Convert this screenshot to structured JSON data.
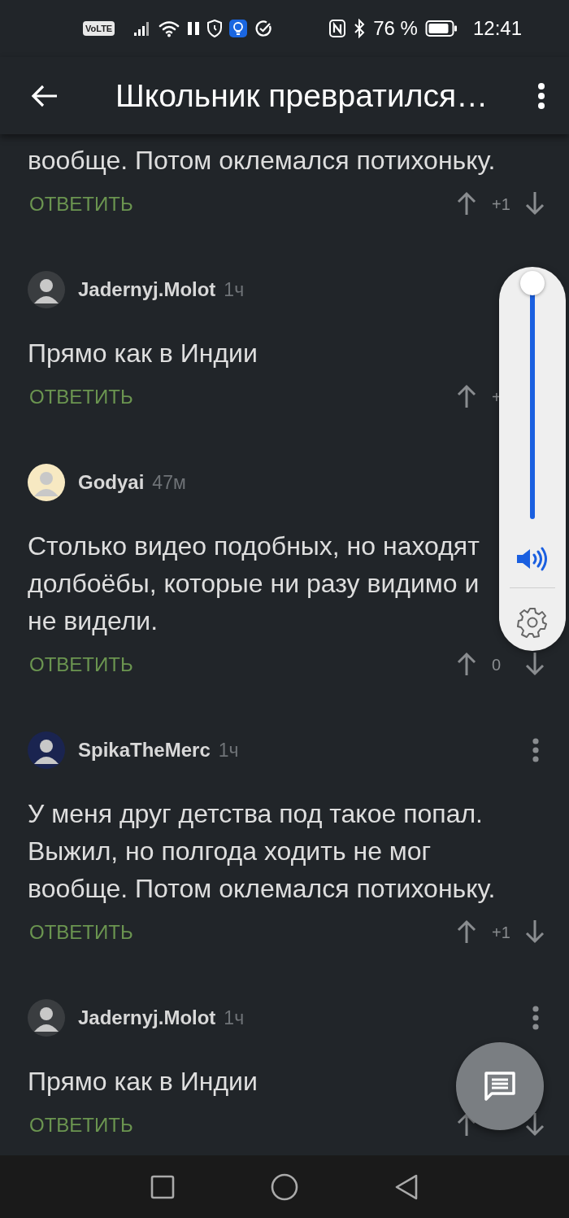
{
  "status_bar": {
    "volte": "VoLTE",
    "battery": "76 %",
    "time": "12:41"
  },
  "header": {
    "title": "Школьник превратился…"
  },
  "comments": [
    {
      "text": "вообще. Потом оклемался потихоньку.",
      "reply": "ОТВЕТИТЬ",
      "score": "+1",
      "down_arrow": true
    },
    {
      "author": "Jadernyj.Molot",
      "time": "1ч",
      "color": "#3a3d40",
      "menu": false,
      "text": "Прямо как в Индии",
      "reply": "ОТВЕТИТЬ",
      "score": "+",
      "down_arrow": false
    },
    {
      "author": "Godyai",
      "time": "47м",
      "color": "#f7e9c2",
      "menu": false,
      "text": "Столько видео подобных, но находят\nдолбоёбы, которые ни разу видимо и\nне видели.",
      "reply": "ОТВЕТИТЬ",
      "score": "0",
      "down_arrow": true
    },
    {
      "author": "SpikaTheMerc",
      "time": "1ч",
      "color": "#1a2450",
      "menu": true,
      "text": "У меня друг детства под такое попал. Выжил, но полгода ходить не мог вообще. Потом оклемался потихоньку.",
      "reply": "ОТВЕТИТЬ",
      "score": "+1",
      "down_arrow": true
    },
    {
      "author": "Jadernyj.Molot",
      "time": "1ч",
      "color": "#3a3d40",
      "menu": true,
      "text": "Прямо как в Индии",
      "reply": "ОТВЕТИТЬ",
      "down_arrow": true
    }
  ],
  "volume": {
    "level": 1
  }
}
